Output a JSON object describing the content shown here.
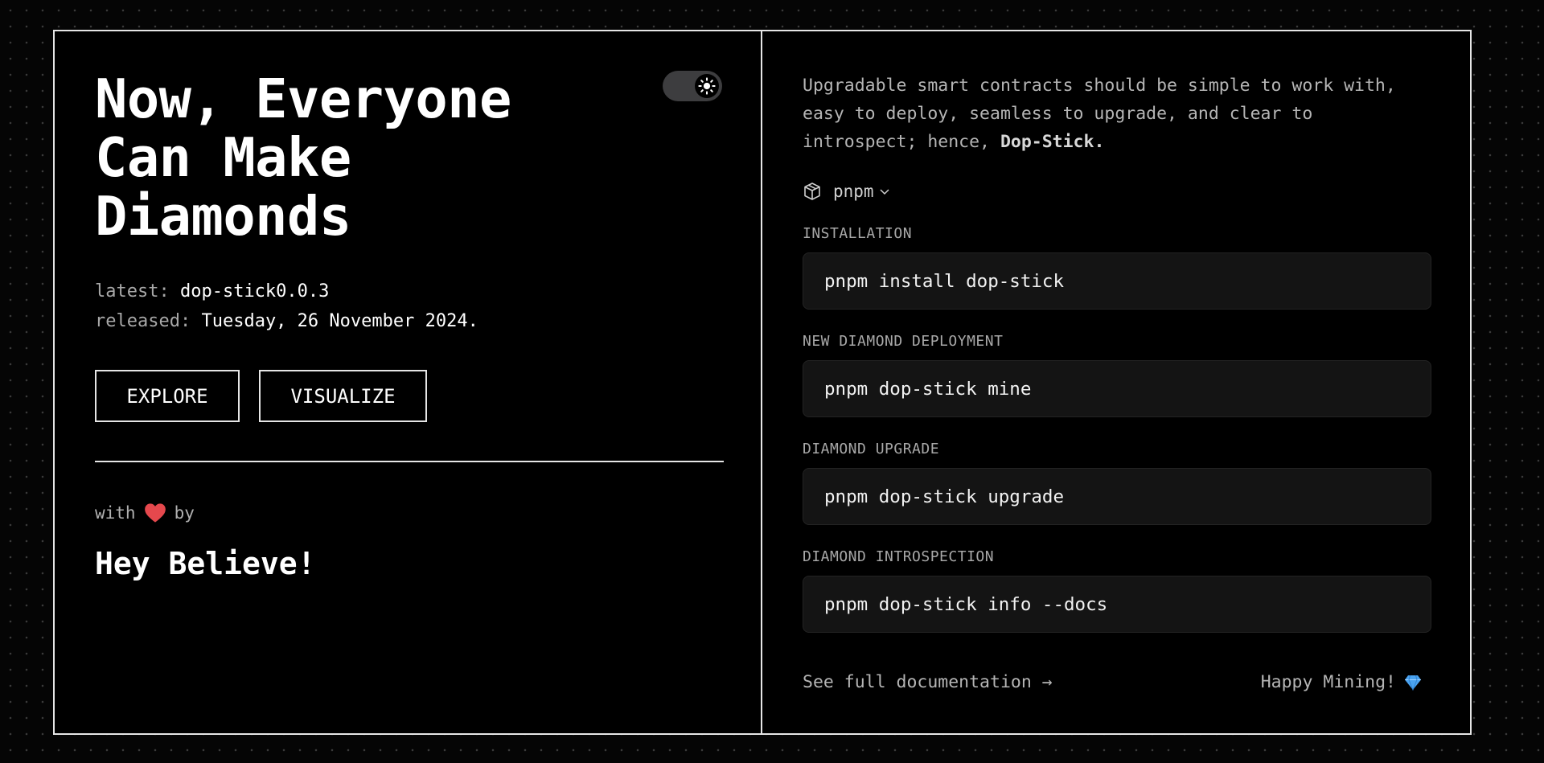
{
  "hero": {
    "headline_line1": "Now, Everyone",
    "headline_line2": "Can Make",
    "headline_line3": "Diamonds"
  },
  "theme_toggle": {
    "icon": "sun-icon",
    "state": "light-mode-toggle"
  },
  "release": {
    "latest_label": "latest:",
    "latest_value": "dop-stick0.0.3",
    "released_label": "released:",
    "released_value": "Tuesday, 26 November 2024."
  },
  "actions": {
    "explore": "EXPLORE",
    "visualize": "VISUALIZE"
  },
  "credits": {
    "with": "with",
    "by": "by",
    "heart_icon": "heart-icon",
    "author": "Hey Believe!"
  },
  "intro": {
    "text": "Upgradable smart contracts should be simple to work with, easy to deploy, seamless to upgrade, and clear to introspect; hence, ",
    "brand": "Dop-Stick."
  },
  "package_manager": {
    "icon": "package-icon",
    "selected": "pnpm"
  },
  "sections": [
    {
      "label": "INSTALLATION",
      "command": "pnpm install dop-stick"
    },
    {
      "label": "NEW DIAMOND DEPLOYMENT",
      "command": "pnpm dop-stick mine"
    },
    {
      "label": "DIAMOND UPGRADE",
      "command": "pnpm dop-stick upgrade"
    },
    {
      "label": "DIAMOND INTROSPECTION",
      "command": "pnpm dop-stick info --docs"
    }
  ],
  "footer": {
    "docs_link": "See full documentation →",
    "happy": "Happy Mining!",
    "gem_icon": "gem-icon"
  },
  "colors": {
    "background": "#000000",
    "border": "#e6e6e6",
    "code_bg": "#141414",
    "heart": "#e5484d",
    "gem": "#4aa3f0"
  }
}
